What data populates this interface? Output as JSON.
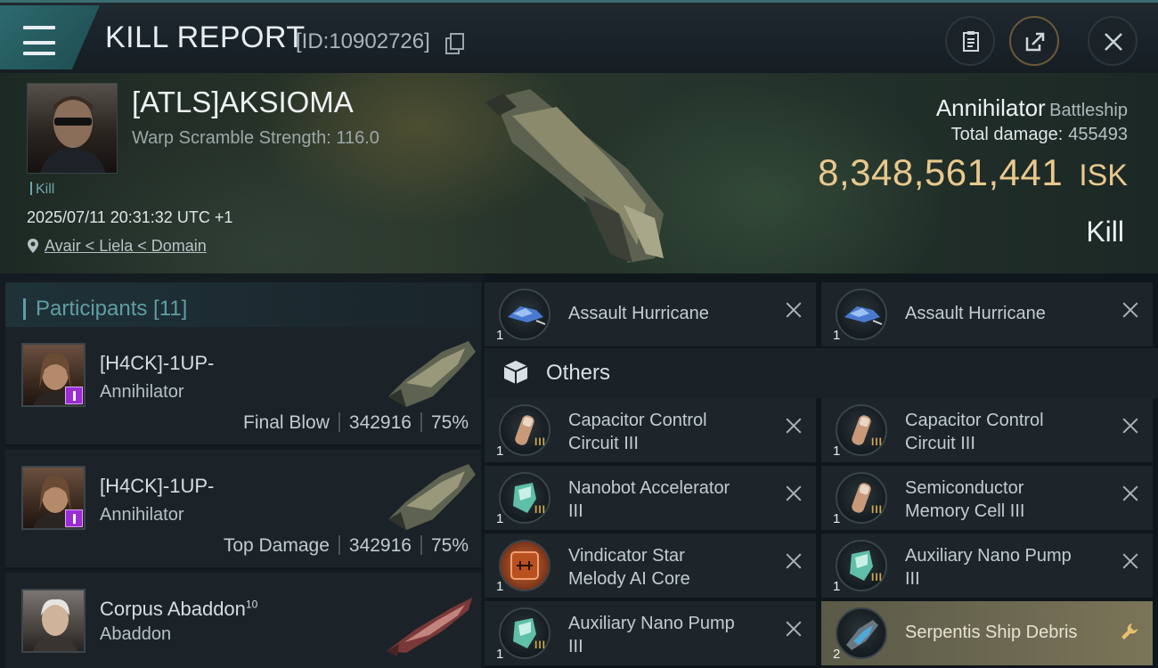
{
  "header": {
    "title": "KILL REPORT",
    "report_id": "[ID:10902726]",
    "icons": [
      "menu-icon",
      "copy-icon",
      "clipboard-icon",
      "share-icon",
      "close-icon"
    ]
  },
  "victim": {
    "name": "[ATLS]AKSIOMA",
    "warp_scramble": "Warp Scramble Strength: 116.0",
    "tag": "Kill",
    "datetime": "2025/07/11 20:31:32 UTC +1",
    "location": "Avair < Liela < Domain",
    "ship_name": "Annihilator",
    "ship_class": "Battleship",
    "total_damage_label": "Total damage:",
    "total_damage": "455493",
    "isk_value": "8,348,561,441",
    "isk_unit": "ISK",
    "result": "Kill"
  },
  "participants": {
    "label": "Participants [11]",
    "rows": [
      {
        "name": "[H4CK]-1UP-",
        "sup": "",
        "ship": "Annihilator",
        "role": "Final Blow",
        "damage": "342916",
        "percent": "75%",
        "badge": true
      },
      {
        "name": "[H4CK]-1UP-",
        "sup": "",
        "ship": "Annihilator",
        "role": "Top Damage",
        "damage": "342916",
        "percent": "75%",
        "badge": true
      },
      {
        "name": "Corpus Abaddon",
        "sup": "10",
        "ship": "Abaddon",
        "role": "",
        "damage": "",
        "percent": "",
        "badge": false
      }
    ]
  },
  "items": {
    "drones": [
      {
        "name": "Assault Hurricane",
        "qty": "1",
        "icon": "drone-icon"
      },
      {
        "name": "Assault Hurricane",
        "qty": "1",
        "icon": "drone-icon"
      }
    ],
    "others_label": "Others",
    "others": [
      {
        "line1": "Capacitor Control",
        "line2": "Circuit III",
        "qty": "1",
        "meta": "III",
        "icon": "capacitor-rig-icon"
      },
      {
        "line1": "Capacitor Control",
        "line2": "Circuit III",
        "qty": "1",
        "meta": "III",
        "icon": "capacitor-rig-icon"
      },
      {
        "line1": "Nanobot Accelerator",
        "line2": "III",
        "qty": "1",
        "meta": "III",
        "icon": "nano-rig-icon"
      },
      {
        "line1": "Semiconductor",
        "line2": "Memory Cell III",
        "qty": "1",
        "meta": "III",
        "icon": "capacitor-rig-icon"
      },
      {
        "line1": "Vindicator Star",
        "line2": "Melody AI Core",
        "qty": "1",
        "meta": "",
        "icon": "ai-core-icon"
      },
      {
        "line1": "Auxiliary Nano Pump",
        "line2": "III",
        "qty": "1",
        "meta": "III",
        "icon": "nano-rig-icon"
      },
      {
        "line1": "Auxiliary Nano Pump",
        "line2": "III",
        "qty": "1",
        "meta": "III",
        "icon": "nano-rig-icon"
      },
      {
        "line1": "Serpentis Ship Debris",
        "line2": "",
        "qty": "2",
        "meta": "",
        "icon": "debris-icon"
      }
    ]
  },
  "colors": {
    "accent": "#5f9ea3",
    "isk": "#e9c88d",
    "share_ring": "#6a5a36",
    "badge": "#9b2cd6"
  }
}
